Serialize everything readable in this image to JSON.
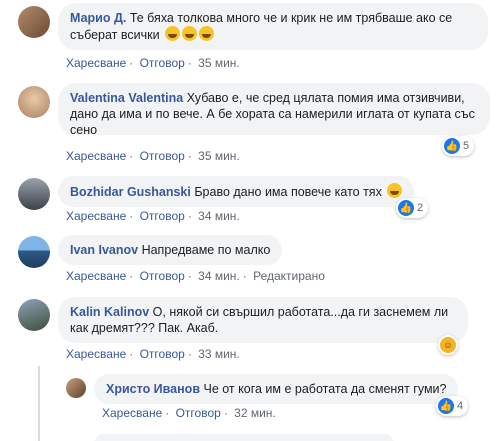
{
  "actions": {
    "like": "Харесване",
    "reply": "Отговор",
    "edited": "Редактирано"
  },
  "comments": [
    {
      "name": "Марио Д.",
      "text": "Те бяха толкова много че и крик не им трябваше ако се съберат всички",
      "time": "35 мин.",
      "emojis": 3
    },
    {
      "name": "Valentina Valentina",
      "text": "Хубаво е, че сред цялата помия има отзивчиви, дано да има и по вече. А бе хората са намерили иглата от купата със сено",
      "time": "35 мин.",
      "reactions": "5",
      "reaction_icon": "like-icon"
    },
    {
      "name": "Bozhidar Gushanski",
      "text": "Браво дано има повече като тях",
      "time": "34 мин.",
      "reactions": "2",
      "reaction_icon": "like-icon",
      "emojis": 1
    },
    {
      "name": "Ivan Ivanov",
      "text": "Напредваме по малко",
      "time": "34 мин."
    },
    {
      "name": "Kalin Kalinov",
      "text": "О, някой си свършил работата...да ги заснемем ли как дремят??? Пак. Акаб.",
      "time": "33 мин.",
      "reaction_icon": "haha-icon"
    },
    {
      "name": "Христо Иванов",
      "text": "Че от кога им е работата да сменят гуми?",
      "time": "32 мин.",
      "reactions": "4",
      "reaction_icon": "like-icon"
    }
  ],
  "colors": {
    "link": "#385898",
    "bubble": "#f2f3f5",
    "like": "#1877f2",
    "haha": "#f7b125"
  }
}
